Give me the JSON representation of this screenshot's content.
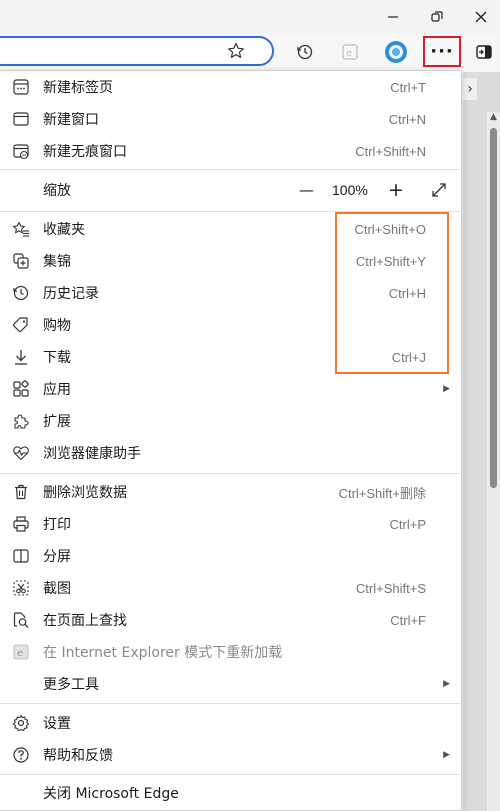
{
  "toolbar": {
    "more_label": "···"
  },
  "menu": {
    "new_tab": {
      "label": "新建标签页",
      "shortcut": "Ctrl+T"
    },
    "new_window": {
      "label": "新建窗口",
      "shortcut": "Ctrl+N"
    },
    "new_inprivate": {
      "label": "新建无痕窗口",
      "shortcut": "Ctrl+Shift+N"
    },
    "zoom": {
      "label": "缩放",
      "value": "100%",
      "minus": "—",
      "plus": "+"
    },
    "favorites": {
      "label": "收藏夹",
      "shortcut": "Ctrl+Shift+O"
    },
    "collections": {
      "label": "集锦",
      "shortcut": "Ctrl+Shift+Y"
    },
    "history": {
      "label": "历史记录",
      "shortcut": "Ctrl+H"
    },
    "shopping": {
      "label": "购物"
    },
    "downloads": {
      "label": "下载",
      "shortcut": "Ctrl+J"
    },
    "apps": {
      "label": "应用"
    },
    "extensions": {
      "label": "扩展"
    },
    "browser_essentials": {
      "label": "浏览器健康助手"
    },
    "clear_data": {
      "label": "删除浏览数据",
      "shortcut": "Ctrl+Shift+删除"
    },
    "print": {
      "label": "打印",
      "shortcut": "Ctrl+P"
    },
    "split_screen": {
      "label": "分屏"
    },
    "screenshot": {
      "label": "截图",
      "shortcut": "Ctrl+Shift+S"
    },
    "find": {
      "label": "在页面上查找",
      "shortcut": "Ctrl+F"
    },
    "ie_mode": {
      "label": "在 Internet Explorer 模式下重新加载"
    },
    "more_tools": {
      "label": "更多工具"
    },
    "settings": {
      "label": "设置"
    },
    "help": {
      "label": "帮助和反馈"
    },
    "close": {
      "label": "关闭 Microsoft Edge"
    }
  },
  "colors": {
    "address_border": "#2f6fdd",
    "more_button_highlight": "#e0182b",
    "shortcut_highlight": "#ee7a2b"
  }
}
